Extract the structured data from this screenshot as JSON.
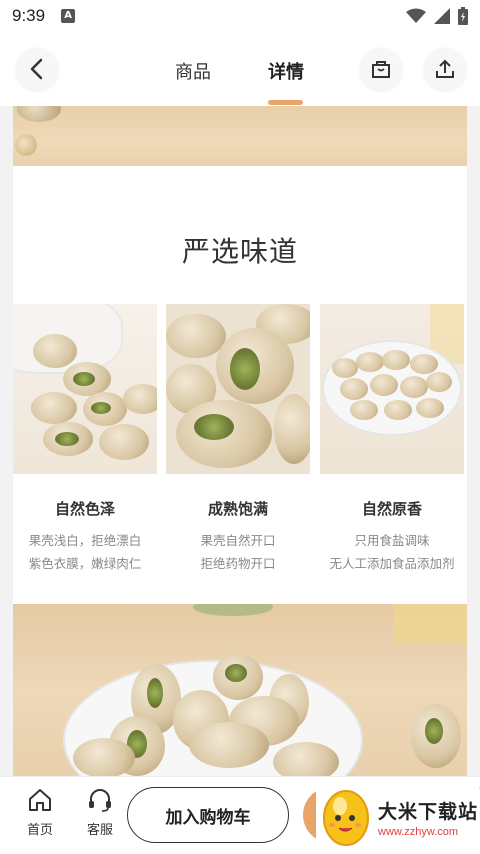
{
  "status_bar": {
    "time": "9:39",
    "notification_icon": "a-icon"
  },
  "nav": {
    "tabs": [
      {
        "label": "商品"
      },
      {
        "label": "详情"
      }
    ],
    "active_tab": "详情",
    "accent_color": "#e9a469"
  },
  "section": {
    "title": "严选味道",
    "features": [
      {
        "name": "自然色泽",
        "desc_line1": "果壳浅白，拒绝漂白",
        "desc_line2": "紫色衣膜，嫩绿肉仁"
      },
      {
        "name": "成熟饱满",
        "desc_line1": "果壳自然开口",
        "desc_line2": "拒绝药物开口"
      },
      {
        "name": "自然原香",
        "desc_line1": "只用食盐调味",
        "desc_line2": "无人工添加食品添加剂"
      }
    ]
  },
  "bottom_bar": {
    "home_label": "首页",
    "service_label": "客服",
    "cart_label": "加入购物车"
  },
  "watermark": {
    "title": "大米下载站",
    "url": "www.zzhyw.com"
  }
}
